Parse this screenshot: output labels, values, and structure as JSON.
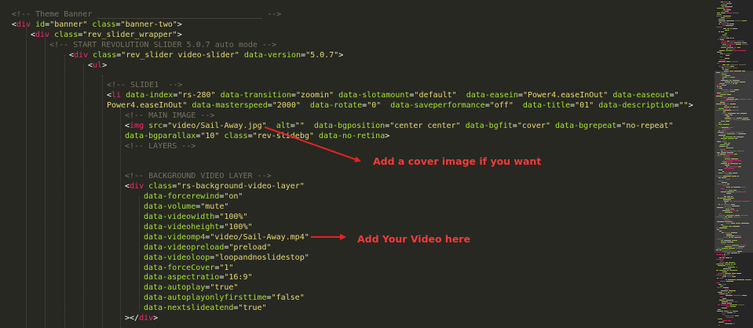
{
  "code_lines": [
    [
      [
        "cm",
        "<!-- Theme Banner ___________________________________ -->"
      ]
    ],
    [
      [
        "pn",
        "<"
      ],
      [
        "tg",
        "div"
      ],
      [
        "pn",
        " "
      ],
      [
        "at",
        "id"
      ],
      [
        "pn",
        "="
      ],
      [
        "vl",
        "\"banner\""
      ],
      [
        "pn",
        " "
      ],
      [
        "at",
        "class"
      ],
      [
        "pn",
        "="
      ],
      [
        "vl",
        "\"banner-two\""
      ],
      [
        "pn",
        ">"
      ]
    ],
    [
      [
        "pn",
        "<"
      ],
      [
        "tg",
        "div"
      ],
      [
        "pn",
        " "
      ],
      [
        "at",
        "class"
      ],
      [
        "pn",
        "="
      ],
      [
        "vl",
        "\"rev_slider_wrapper\""
      ],
      [
        "pn",
        ">"
      ]
    ],
    [
      [
        "cm",
        "<!-- START REVOLUTION SLIDER 5.0.7 auto mode -->"
      ]
    ],
    [
      [
        "pn",
        "<"
      ],
      [
        "tg",
        "div"
      ],
      [
        "pn",
        " "
      ],
      [
        "at",
        "class"
      ],
      [
        "pn",
        "="
      ],
      [
        "vl",
        "\"rev_slider video-slider\""
      ],
      [
        "pn",
        " "
      ],
      [
        "at",
        "data-version"
      ],
      [
        "pn",
        "="
      ],
      [
        "vl",
        "\"5.0.7\""
      ],
      [
        "pn",
        ">"
      ]
    ],
    [
      [
        "pn",
        "<"
      ],
      [
        "tg",
        "ul"
      ],
      [
        "pn",
        ">"
      ]
    ],
    [],
    [
      [
        "cm",
        "<!-- SLIDE1  -->"
      ]
    ],
    [
      [
        "pn",
        "<"
      ],
      [
        "tg",
        "li"
      ],
      [
        "pn",
        " "
      ],
      [
        "at",
        "data-index"
      ],
      [
        "pn",
        "="
      ],
      [
        "vl",
        "\"rs-280\""
      ],
      [
        "pn",
        " "
      ],
      [
        "at",
        "data-transition"
      ],
      [
        "pn",
        "="
      ],
      [
        "vl",
        "\"zoomin\""
      ],
      [
        "pn",
        " "
      ],
      [
        "at",
        "data-slotamount"
      ],
      [
        "pn",
        "="
      ],
      [
        "vl",
        "\"default\""
      ],
      [
        "pn",
        "  "
      ],
      [
        "at",
        "data-easein"
      ],
      [
        "pn",
        "="
      ],
      [
        "vl",
        "\"Power4.easeInOut\""
      ],
      [
        "pn",
        " "
      ],
      [
        "at",
        "data-easeout"
      ],
      [
        "pn",
        "="
      ],
      [
        "vl",
        "\""
      ]
    ],
    [
      [
        "vl",
        "Power4.easeInOut\""
      ],
      [
        "pn",
        " "
      ],
      [
        "at",
        "data-masterspeed"
      ],
      [
        "pn",
        "="
      ],
      [
        "vl",
        "\"2000\""
      ],
      [
        "pn",
        "  "
      ],
      [
        "at",
        "data-rotate"
      ],
      [
        "pn",
        "="
      ],
      [
        "vl",
        "\"0\""
      ],
      [
        "pn",
        "  "
      ],
      [
        "at",
        "data-saveperformance"
      ],
      [
        "pn",
        "="
      ],
      [
        "vl",
        "\"off\""
      ],
      [
        "pn",
        "  "
      ],
      [
        "at",
        "data-title"
      ],
      [
        "pn",
        "="
      ],
      [
        "vl",
        "\"01\""
      ],
      [
        "pn",
        " "
      ],
      [
        "at",
        "data-description"
      ],
      [
        "pn",
        "="
      ],
      [
        "vl",
        "\"\""
      ],
      [
        "pn",
        ">"
      ]
    ],
    [
      [
        "cm",
        "<!-- MAIN IMAGE -->"
      ]
    ],
    [
      [
        "pn",
        "<"
      ],
      [
        "tg",
        "img"
      ],
      [
        "pn",
        " "
      ],
      [
        "at",
        "src"
      ],
      [
        "pn",
        "="
      ],
      [
        "vl",
        "\"video/Sail-Away.jpg\""
      ],
      [
        "pn",
        "  "
      ],
      [
        "at",
        "alt"
      ],
      [
        "pn",
        "="
      ],
      [
        "vl",
        "\"\""
      ],
      [
        "pn",
        "  "
      ],
      [
        "at",
        "data-bgposition"
      ],
      [
        "pn",
        "="
      ],
      [
        "vl",
        "\"center center\""
      ],
      [
        "pn",
        " "
      ],
      [
        "at",
        "data-bgfit"
      ],
      [
        "pn",
        "="
      ],
      [
        "vl",
        "\"cover\""
      ],
      [
        "pn",
        " "
      ],
      [
        "at",
        "data-bgrepeat"
      ],
      [
        "pn",
        "="
      ],
      [
        "vl",
        "\"no-repeat\""
      ]
    ],
    [
      [
        "at",
        "data-bgparallax"
      ],
      [
        "pn",
        "="
      ],
      [
        "vl",
        "\"10\""
      ],
      [
        "pn",
        " "
      ],
      [
        "at",
        "class"
      ],
      [
        "pn",
        "="
      ],
      [
        "vl",
        "\"rev-slidebg\""
      ],
      [
        "pn",
        " "
      ],
      [
        "at",
        "data-no-retina"
      ],
      [
        "pn",
        ">"
      ]
    ],
    [
      [
        "cm",
        "<!-- LAYERS -->"
      ]
    ],
    [],
    [],
    [
      [
        "cm",
        "<!-- BACKGROUND VIDEO LAYER -->"
      ]
    ],
    [
      [
        "pn",
        "<"
      ],
      [
        "tg",
        "div"
      ],
      [
        "pn",
        " "
      ],
      [
        "at",
        "class"
      ],
      [
        "pn",
        "="
      ],
      [
        "vl",
        "\"rs-background-video-layer\""
      ]
    ],
    [
      [
        "at",
        "data-forcerewind"
      ],
      [
        "pn",
        "="
      ],
      [
        "vl",
        "\"on\""
      ]
    ],
    [
      [
        "at",
        "data-volume"
      ],
      [
        "pn",
        "="
      ],
      [
        "vl",
        "\"mute\""
      ]
    ],
    [
      [
        "at",
        "data-videowidth"
      ],
      [
        "pn",
        "="
      ],
      [
        "vl",
        "\"100%\""
      ]
    ],
    [
      [
        "at",
        "data-videoheight"
      ],
      [
        "pn",
        "="
      ],
      [
        "vl",
        "\"100%\""
      ]
    ],
    [
      [
        "at",
        "data-videomp4"
      ],
      [
        "pn",
        "="
      ],
      [
        "vl",
        "\"video/Sail-Away.mp4\""
      ]
    ],
    [
      [
        "at",
        "data-videopreload"
      ],
      [
        "pn",
        "="
      ],
      [
        "vl",
        "\"preload\""
      ]
    ],
    [
      [
        "at",
        "data-videoloop"
      ],
      [
        "pn",
        "="
      ],
      [
        "vl",
        "\"loopandnoslidestop\""
      ]
    ],
    [
      [
        "at",
        "data-forceCover"
      ],
      [
        "pn",
        "="
      ],
      [
        "vl",
        "\"1\""
      ]
    ],
    [
      [
        "at",
        "data-aspectratio"
      ],
      [
        "pn",
        "="
      ],
      [
        "vl",
        "\"16:9\""
      ]
    ],
    [
      [
        "at",
        "data-autoplay"
      ],
      [
        "pn",
        "="
      ],
      [
        "vl",
        "\"true\""
      ]
    ],
    [
      [
        "at",
        "data-autoplayonlyfirsttime"
      ],
      [
        "pn",
        "="
      ],
      [
        "vl",
        "\"false\""
      ]
    ],
    [
      [
        "at",
        "data-nextslideatend"
      ],
      [
        "pn",
        "="
      ],
      [
        "vl",
        "\"true\""
      ]
    ],
    [
      [
        "pn",
        ">"
      ],
      [
        "pn",
        "</"
      ],
      [
        "tg",
        "div"
      ],
      [
        "pn",
        ">"
      ]
    ]
  ],
  "annotations": {
    "cover_image": "Add a cover image if you want",
    "video": "Add Your Video here"
  },
  "colors": {
    "background": "#272822",
    "comment": "#75715e",
    "tag": "#f92672",
    "attribute": "#a6e22e",
    "string": "#e6db74",
    "punctuation": "#f8f8f2",
    "annotation": "#f23a3a"
  }
}
